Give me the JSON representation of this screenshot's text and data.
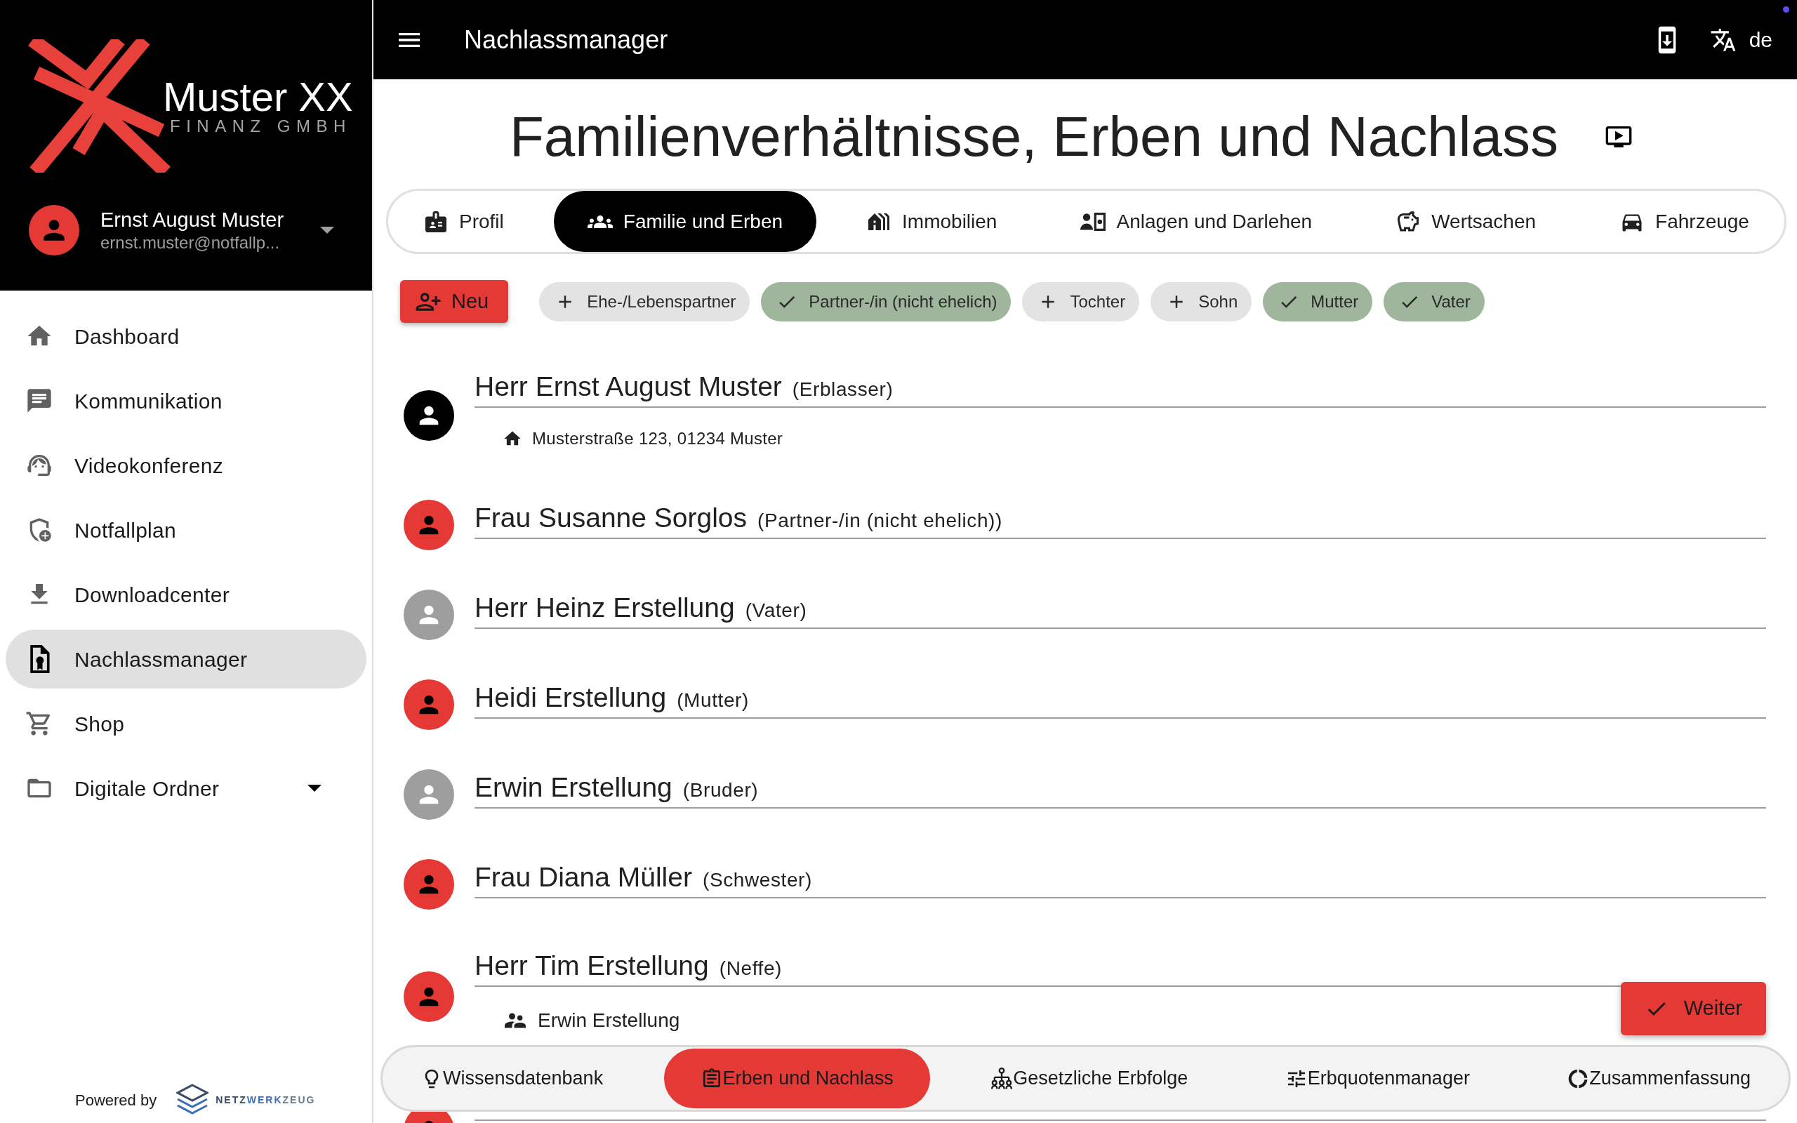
{
  "sidebar": {
    "logo": {
      "name": "Muster XX",
      "subtitle": "FINANZ GMBH"
    },
    "user": {
      "name": "Ernst August Muster",
      "email": "ernst.muster@notfallp..."
    },
    "items": [
      {
        "label": "Dashboard",
        "kind": "link",
        "selected": false
      },
      {
        "label": "Kommunikation",
        "kind": "link",
        "selected": false
      },
      {
        "label": "Videokonferenz",
        "kind": "link",
        "selected": false
      },
      {
        "label": "Notfallplan",
        "kind": "link",
        "selected": false
      },
      {
        "label": "Downloadcenter",
        "kind": "link",
        "selected": false
      },
      {
        "label": "Nachlassmanager",
        "kind": "link",
        "selected": true
      },
      {
        "label": "Shop",
        "kind": "link",
        "selected": false
      },
      {
        "label": "Digitale Ordner",
        "kind": "group",
        "selected": false
      }
    ],
    "powered_by": {
      "label": "Powered by",
      "brand": [
        "NETZ",
        "WERK",
        "ZEUG"
      ]
    }
  },
  "app_bar": {
    "title": "Nachlassmanager",
    "language": "de"
  },
  "page_title": "Familienverhältnisse, Erben und Nachlass",
  "tabs": [
    {
      "label": "Profil",
      "selected": false
    },
    {
      "label": "Familie und Erben",
      "selected": true
    },
    {
      "label": "Immobilien",
      "selected": false
    },
    {
      "label": "Anlagen und Darlehen",
      "selected": false
    },
    {
      "label": "Wertsachen",
      "selected": false
    },
    {
      "label": "Fahrzeuge",
      "selected": false
    }
  ],
  "new_button": {
    "label": "Neu"
  },
  "chips": [
    {
      "label": "Ehe-/Lebenspartner",
      "checked": false
    },
    {
      "label": "Partner-/in (nicht ehelich)",
      "checked": true
    },
    {
      "label": "Tochter",
      "checked": false
    },
    {
      "label": "Sohn",
      "checked": false
    },
    {
      "label": "Mutter",
      "checked": true
    },
    {
      "label": "Vater",
      "checked": true
    }
  ],
  "people": [
    {
      "name": "Herr Ernst August Muster",
      "role": "(Erblasser)",
      "color": "#000000",
      "detail": {
        "kind": "address",
        "text": "Musterstraße 123, 01234 Muster"
      }
    },
    {
      "name": "Frau Susanne Sorglos",
      "role": "(Partner-/in (nicht ehelich))",
      "color": "#e53935"
    },
    {
      "name": "Herr Heinz Erstellung",
      "role": "(Vater)",
      "color": "#9e9e9e"
    },
    {
      "name": "Heidi Erstellung",
      "role": "(Mutter)",
      "color": "#e53935"
    },
    {
      "name": "Erwin Erstellung",
      "role": "(Bruder)",
      "color": "#9e9e9e"
    },
    {
      "name": "Frau Diana Müller",
      "role": "(Schwester)",
      "color": "#e53935"
    },
    {
      "name": "Herr Tim Erstellung",
      "role": "(Neffe)",
      "color": "#e53935",
      "detail": {
        "kind": "relative",
        "text": "Erwin Erstellung"
      }
    },
    {
      "color": "#e53935"
    }
  ],
  "continue_button": {
    "label": "Weiter"
  },
  "bottom_nav": [
    {
      "label": "Wissensdatenbank",
      "selected": false
    },
    {
      "label": "Erben und Nachlass",
      "selected": true
    },
    {
      "label": "Gesetzliche Erbfolge",
      "selected": false
    },
    {
      "label": "Erbquotenmanager",
      "selected": false
    },
    {
      "label": "Zusammenfassung",
      "selected": false
    }
  ]
}
